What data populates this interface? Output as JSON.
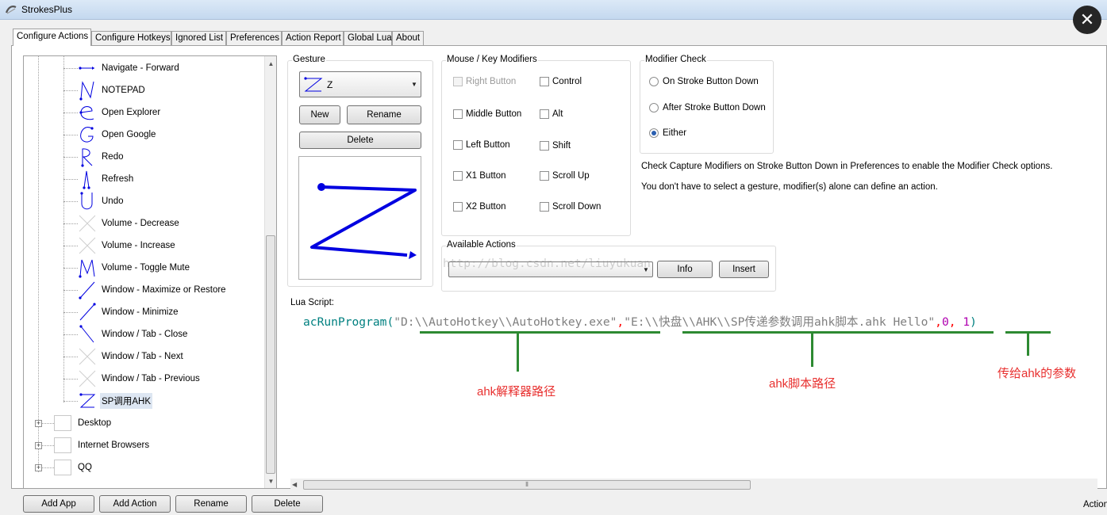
{
  "window": {
    "title": "StrokesPlus",
    "close_icon": "close-icon"
  },
  "tabs": [
    {
      "label": "Configure Actions",
      "active": true
    },
    {
      "label": "Configure Hotkeys"
    },
    {
      "label": "Ignored List"
    },
    {
      "label": "Preferences"
    },
    {
      "label": "Action Report"
    },
    {
      "label": "Global Lua"
    },
    {
      "label": "About"
    }
  ],
  "tree": {
    "actions": [
      {
        "label": "Navigate - Forward",
        "icon": "gesture-line-right-icon"
      },
      {
        "label": "NOTEPAD",
        "icon": "gesture-n-icon"
      },
      {
        "label": "Open Explorer",
        "icon": "gesture-e-icon"
      },
      {
        "label": "Open Google",
        "icon": "gesture-g-icon"
      },
      {
        "label": "Redo",
        "icon": "gesture-r-icon"
      },
      {
        "label": "Refresh",
        "icon": "gesture-up-down-icon"
      },
      {
        "label": "Undo",
        "icon": "gesture-u-icon"
      },
      {
        "label": "Volume - Decrease",
        "icon": "no-gesture-icon"
      },
      {
        "label": "Volume - Increase",
        "icon": "no-gesture-icon"
      },
      {
        "label": "Volume - Toggle Mute",
        "icon": "gesture-m-icon"
      },
      {
        "label": "Window - Maximize or Restore",
        "icon": "gesture-diagonal-up-icon"
      },
      {
        "label": "Window - Minimize",
        "icon": "gesture-diagonal-down-icon"
      },
      {
        "label": "Window / Tab - Close",
        "icon": "gesture-diagonal-close-icon"
      },
      {
        "label": "Window / Tab - Next",
        "icon": "no-gesture-icon"
      },
      {
        "label": "Window / Tab - Previous",
        "icon": "no-gesture-icon"
      },
      {
        "label": "SP调用AHK",
        "icon": "gesture-z-icon",
        "selected": true
      }
    ],
    "apps": [
      {
        "label": "Desktop",
        "expander": "+"
      },
      {
        "label": "Internet Browsers",
        "expander": "+"
      },
      {
        "label": "QQ",
        "expander": "+"
      }
    ]
  },
  "gesture": {
    "group_label": "Gesture",
    "selected": "Z",
    "new_label": "New",
    "rename_label": "Rename",
    "delete_label": "Delete"
  },
  "modifiers": {
    "group_label": "Mouse / Key Modifiers",
    "left": [
      {
        "label": "Right Button",
        "disabled": true
      },
      {
        "label": "Middle Button"
      },
      {
        "label": "Left Button"
      },
      {
        "label": "X1 Button"
      },
      {
        "label": "X2 Button"
      }
    ],
    "right": [
      {
        "label": "Control"
      },
      {
        "label": "Alt"
      },
      {
        "label": "Shift"
      },
      {
        "label": "Scroll Up"
      },
      {
        "label": "Scroll Down"
      }
    ]
  },
  "modifier_check": {
    "group_label": "Modifier Check",
    "options": [
      {
        "label": "On Stroke Button Down",
        "selected": false
      },
      {
        "label": "After Stroke Button Down",
        "selected": false
      },
      {
        "label": "Either",
        "selected": true
      }
    ]
  },
  "hints": {
    "line1": "Check Capture Modifiers on Stroke Button Down in Preferences to enable the Modifier Check options.",
    "line2": "You don't have to select a gesture, modifier(s) alone can define an action."
  },
  "available_actions": {
    "group_label": "Available Actions",
    "info_label": "Info",
    "insert_label": "Insert",
    "watermark": "http://blog.csdn.net/liuyukuan"
  },
  "lua": {
    "label": "Lua Script:",
    "tokens": {
      "fn": "acRunProgram",
      "open": "(",
      "arg1": "\"D:\\\\AutoHotkey\\\\AutoHotkey.exe\"",
      "comma1": ",",
      "arg2": "\"E:\\\\快盘\\\\AHK\\\\SP传递参数调用ahk脚本.ahk Hello\"",
      "comma2": ",",
      "n0": "0",
      "comma3": ", ",
      "n1": "1",
      "close": ")"
    }
  },
  "annotations": {
    "interpreter_path": "ahk解释器路径",
    "script_path": "ahk脚本路径",
    "params": "传给ahk的参数",
    "color": "#2d8a32",
    "text_color": "#e8302f"
  },
  "bottom": {
    "add_app": "Add App",
    "add_action": "Add Action",
    "rename": "Rename",
    "delete": "Delete",
    "status": "Action"
  },
  "colors": {
    "stroke_blue": "#0000e0",
    "selection": "#dde6f2"
  }
}
